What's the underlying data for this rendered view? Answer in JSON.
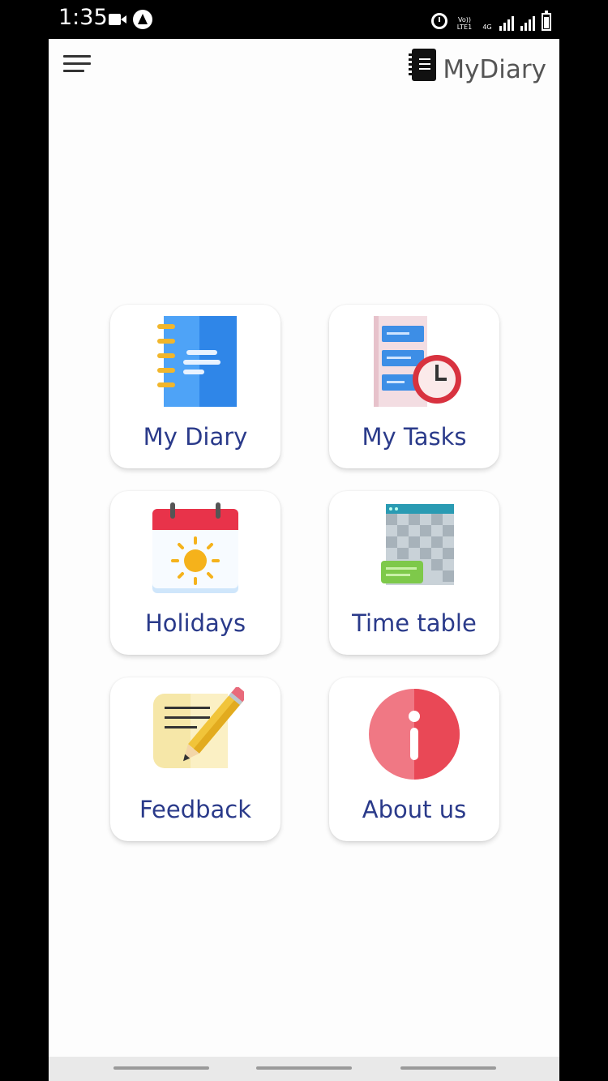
{
  "status_bar": {
    "time": "1:35",
    "network_label_top": "Vo)) LTE1",
    "network_label_4g": "4G"
  },
  "header": {
    "app_title": "MyDiary"
  },
  "tiles": [
    {
      "label": "My Diary",
      "icon": "notebook-icon"
    },
    {
      "label": "My Tasks",
      "icon": "task-clock-icon"
    },
    {
      "label": "Holidays",
      "icon": "calendar-sun-icon"
    },
    {
      "label": "Time table",
      "icon": "timetable-grid-icon"
    },
    {
      "label": "Feedback",
      "icon": "note-pencil-icon"
    },
    {
      "label": "About us",
      "icon": "info-icon"
    }
  ],
  "colors": {
    "label_text": "#2a3a8a",
    "brand_text": "#555555",
    "calendar_red": "#e8334a",
    "info_red": "#ee4d5c",
    "notebook_blue": "#2f86e8"
  }
}
